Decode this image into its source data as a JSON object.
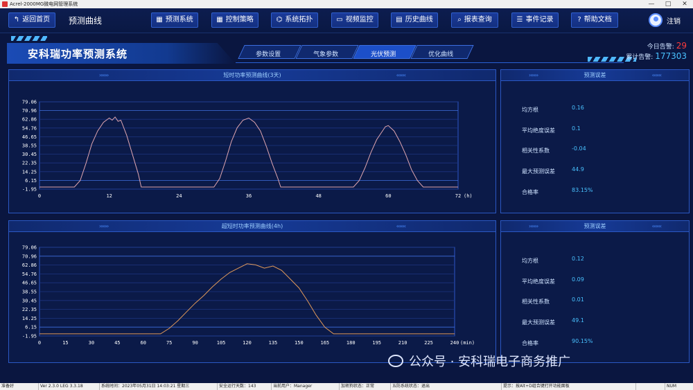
{
  "window": {
    "title": "Acrel-2000MG微电网管理系统",
    "ctrl_min": "—",
    "ctrl_max": "□",
    "ctrl_close": "✕"
  },
  "toolbar": {
    "back": "返回首页",
    "page_name": "预测曲线",
    "buttons": [
      "预测系统",
      "控制策略",
      "系统拓扑",
      "视频监控",
      "历史曲线",
      "报表查询",
      "事件记录",
      "帮助文档"
    ],
    "icons": [
      "grid-icon",
      "grid-icon",
      "topology-icon",
      "camera-icon",
      "doc-icon",
      "search-icon",
      "list-icon",
      "help-icon"
    ],
    "user_label": "注销"
  },
  "banner": {
    "title": "安科瑞功率预测系统",
    "tabs": [
      "参数设置",
      "气象参数",
      "光伏预测",
      "优化曲线"
    ],
    "active_tab": 2,
    "alarm_today_label": "今日告警:",
    "alarm_today_value": "29",
    "alarm_total_label": "累计告警:",
    "alarm_total_value": "177303"
  },
  "short_chart": {
    "title": "短时功率预测曲线(3天)",
    "x_unit": "(h)"
  },
  "ultra_chart": {
    "title": "超短时功率预测曲线(4h)",
    "x_unit": "(min)"
  },
  "short_metrics": {
    "title": "预测误差",
    "rows": [
      {
        "label": "均方根",
        "value": "0.16"
      },
      {
        "label": "平均绝度误差",
        "value": "0.1"
      },
      {
        "label": "相关性系数",
        "value": "-0.04"
      },
      {
        "label": "最大预测误差",
        "value": "44.9"
      },
      {
        "label": "合格率",
        "value": "83.15%"
      }
    ]
  },
  "ultra_metrics": {
    "title": "预测误差",
    "rows": [
      {
        "label": "均方根",
        "value": "0.12"
      },
      {
        "label": "平均绝度误差",
        "value": "0.09"
      },
      {
        "label": "相关性系数",
        "value": "0.01"
      },
      {
        "label": "最大预测误差",
        "value": "49.1"
      },
      {
        "label": "合格率",
        "value": "90.15%"
      }
    ]
  },
  "chart_data": [
    {
      "type": "line",
      "title": "短时功率预测曲线(3天)",
      "xlabel": "(h)",
      "x_ticks": [
        0,
        12,
        24,
        36,
        48,
        60,
        72
      ],
      "y_ticks": [
        -1.95,
        6.15,
        14.25,
        22.35,
        30.45,
        38.55,
        46.65,
        54.76,
        62.86,
        70.96,
        79.06
      ],
      "xlim": [
        0,
        72
      ],
      "ylim": [
        -1.95,
        79.06
      ],
      "series": [
        {
          "color": "#e0a6b0",
          "x": [
            0,
            6,
            7,
            8,
            9,
            10,
            11,
            12,
            12.5,
            13,
            13.5,
            14,
            15,
            16,
            17,
            17.5,
            18,
            30,
            31,
            32,
            33,
            34,
            35,
            36,
            37,
            38,
            39,
            40,
            41,
            41.5,
            42,
            54,
            55,
            56,
            57,
            58,
            59,
            59.5,
            60,
            61,
            62,
            63,
            64,
            65,
            66,
            72
          ],
          "y": [
            0,
            0,
            6,
            22,
            40,
            52,
            60,
            64,
            62,
            65,
            61,
            62,
            48,
            30,
            12,
            0,
            0,
            0,
            8,
            24,
            42,
            55,
            62,
            64,
            60,
            52,
            38,
            22,
            8,
            0,
            0,
            0,
            6,
            18,
            32,
            44,
            52,
            56,
            57,
            52,
            42,
            30,
            16,
            6,
            0,
            0
          ]
        }
      ]
    },
    {
      "type": "line",
      "title": "超短时功率预测曲线(4h)",
      "xlabel": "(min)",
      "x_ticks": [
        0,
        15,
        30,
        45,
        60,
        75,
        90,
        105,
        120,
        135,
        150,
        165,
        180,
        195,
        210,
        225,
        240
      ],
      "y_ticks": [
        -1.95,
        6.15,
        14.25,
        22.35,
        30.45,
        38.55,
        46.65,
        54.76,
        62.86,
        70.96,
        79.06
      ],
      "xlim": [
        0,
        240
      ],
      "ylim": [
        -1.95,
        79.06
      ],
      "series": [
        {
          "color": "#e29a5a",
          "x": [
            0,
            70,
            75,
            80,
            85,
            90,
            95,
            100,
            105,
            110,
            115,
            120,
            125,
            130,
            135,
            140,
            145,
            150,
            155,
            160,
            165,
            170,
            240
          ],
          "y": [
            0,
            0,
            5,
            12,
            20,
            28,
            35,
            43,
            50,
            56,
            60,
            64,
            63,
            60,
            62,
            58,
            50,
            42,
            30,
            17,
            6,
            0,
            0
          ]
        }
      ]
    }
  ],
  "statusbar": {
    "cells": [
      "准备好",
      "Ver 2.3.0 LEG 3.3.18",
      "系统时间：2023年05月31日  14:03:21  星期三",
      "安全运行天数：143",
      "当前用户：Manager",
      "加密狗状态：正常",
      "五防系统状态：退出",
      "提示：按Alt+D组合键打开功能面板",
      "",
      "NUM"
    ]
  },
  "watermark": {
    "text": "公众号 · 安科瑞电子商务推广"
  }
}
